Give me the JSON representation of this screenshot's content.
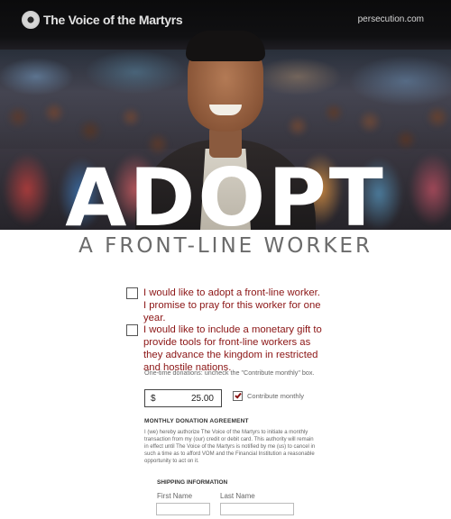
{
  "header": {
    "logo_text": "The Voice of the Martyrs",
    "site_url": "persecution.com"
  },
  "hero": {
    "headline": "ADOPT",
    "subheadline": "A FRONT-LINE WORKER"
  },
  "form": {
    "option_adopt": {
      "label": "I would like to adopt a front-line worker. I promise to pray for this worker for one year.",
      "checked": false
    },
    "option_gift": {
      "label": "I would like to include a monetary gift to provide tools for front-line workers as they advance the kingdom in restricted and hostile nations.",
      "checked": false
    },
    "onetime_note": "One-time donations: uncheck the \"Contribute monthly\" box.",
    "amount": {
      "currency_symbol": "$",
      "value": "25.00"
    },
    "contribute_monthly": {
      "label": "Contribute monthly",
      "checked": true
    },
    "agreement": {
      "title": "MONTHLY DONATION AGREEMENT",
      "text": "I (we) hereby authorize The Voice of the Martyrs to initiate a monthly transaction from my (our) credit or debit card. This authority will remain in effect until The Voice of the Martyrs is notified by me (us) to cancel in such a time as to afford VOM and the Financial Institution a reasonable opportunity to act on it."
    },
    "shipping": {
      "title": "SHIPPING INFORMATION",
      "first_name_label": "First Name",
      "last_name_label": "Last Name",
      "first_name_value": "",
      "last_name_value": ""
    }
  },
  "colors": {
    "accent_red": "#8b1414",
    "subhead_gray": "#6b6b6b"
  }
}
